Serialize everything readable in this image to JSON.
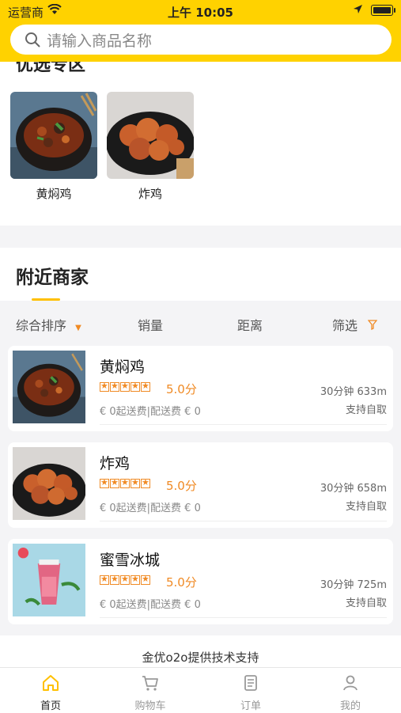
{
  "status_bar": {
    "carrier": "运营商",
    "time": "上午 10:05"
  },
  "search": {
    "placeholder": "请输入商品名称",
    "icon": "search-icon"
  },
  "recommend": {
    "section_title": "优选专区",
    "items": [
      {
        "name": "黄焖鸡"
      },
      {
        "name": "炸鸡"
      }
    ]
  },
  "nearby": {
    "title": "附近商家"
  },
  "sort": {
    "items": [
      "综合排序",
      "销量",
      "距离",
      "筛选"
    ]
  },
  "shops": [
    {
      "name": "黄焖鸡",
      "rating": 5,
      "score": "5.0分",
      "fee": "€ 0起送费|配送费 € 0",
      "distance": "30分钟 633m",
      "pickup": "支持自取"
    },
    {
      "name": "炸鸡",
      "rating": 5,
      "score": "5.0分",
      "fee": "€ 0起送费|配送费 € 0",
      "distance": "30分钟 658m",
      "pickup": "支持自取"
    },
    {
      "name": "蜜雪冰城",
      "rating": 5,
      "score": "5.0分",
      "fee": "€ 0起送费|配送费 € 0",
      "distance": "30分钟 725m",
      "pickup": "支持自取"
    }
  ],
  "footer": {
    "support": "金优o2o提供技术支持"
  },
  "tabbar": {
    "items": [
      {
        "label": "首页",
        "icon": "home-icon",
        "active": true
      },
      {
        "label": "购物车",
        "icon": "cart-icon",
        "active": false
      },
      {
        "label": "订单",
        "icon": "order-icon",
        "active": false
      },
      {
        "label": "我的",
        "icon": "user-icon",
        "active": false
      }
    ]
  },
  "colors": {
    "brand": "#ffd200",
    "accent": "#f08a24",
    "underline": "#ffc000"
  }
}
